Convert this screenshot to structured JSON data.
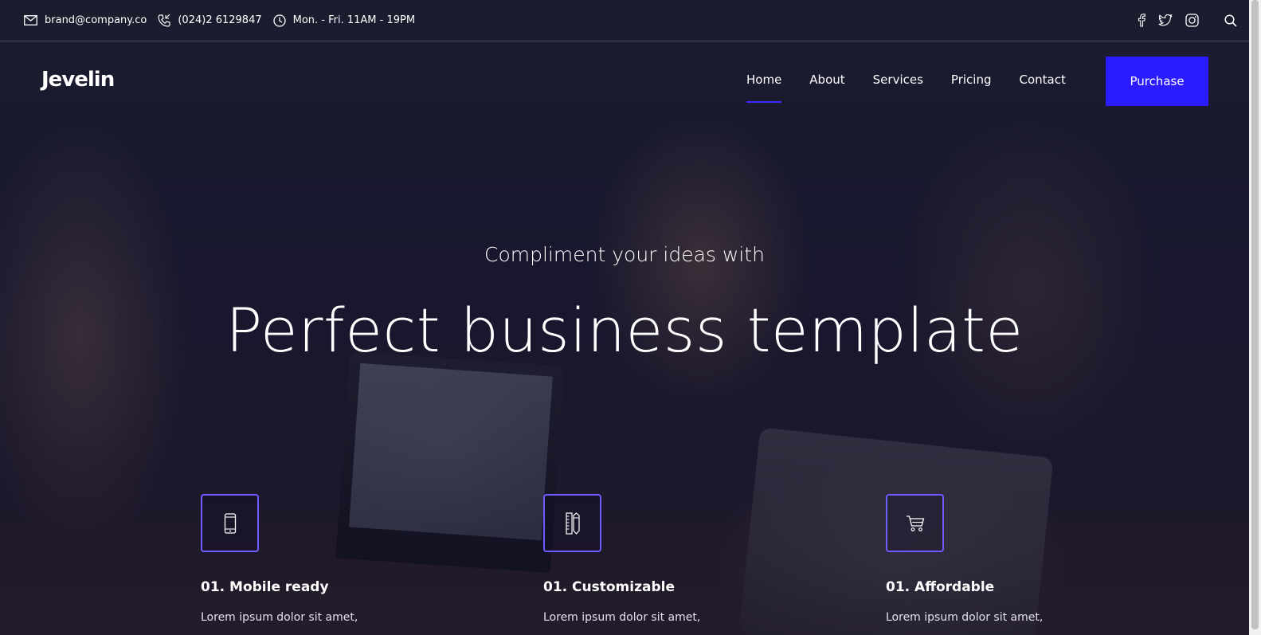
{
  "topbar": {
    "email": "brand@company.co",
    "phone": "(024)2 6129847",
    "hours": "Mon. - Fri. 11AM - 19PM",
    "icons": [
      "mail-icon",
      "phone-icon",
      "clock-icon",
      "facebook-icon",
      "twitter-icon",
      "instagram-icon",
      "search-icon"
    ]
  },
  "brand": {
    "logo": "Jevelin"
  },
  "nav": {
    "items": [
      {
        "label": "Home",
        "active": true
      },
      {
        "label": "About"
      },
      {
        "label": "Services"
      },
      {
        "label": "Pricing"
      },
      {
        "label": "Contact"
      }
    ],
    "purchase_label": "Purchase"
  },
  "hero": {
    "subtitle": "Compliment your ideas with",
    "title": "Perfect business template"
  },
  "features": [
    {
      "icon": "mobile-phone-icon",
      "title": "01. Mobile ready",
      "text": "Lorem ipsum dolor sit amet,"
    },
    {
      "icon": "pencil-ruler-icon",
      "title": "01. Customizable",
      "text": "Lorem ipsum dolor sit amet,"
    },
    {
      "icon": "shopping-cart-icon",
      "title": "01. Affordable",
      "text": "Lorem ipsum dolor sit amet,"
    }
  ],
  "colors": {
    "accent": "#2a1cff",
    "icon_border": "#6d5cff",
    "overlay": "#0c0a23"
  }
}
